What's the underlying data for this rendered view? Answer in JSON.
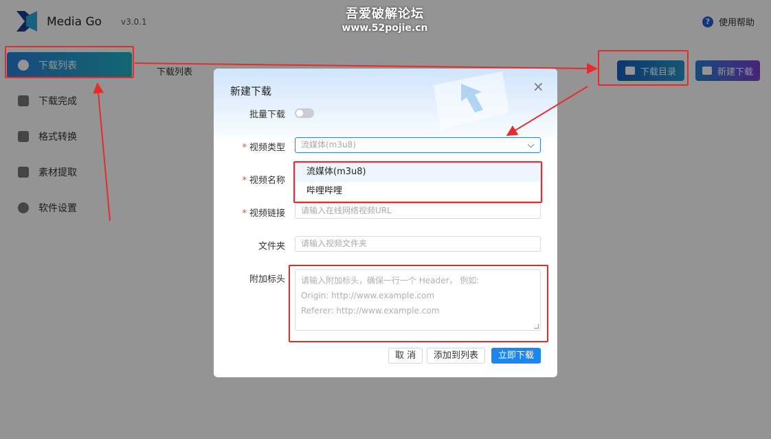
{
  "app": {
    "name": "Media Go",
    "version": "v3.0.1",
    "help_label": "使用帮助"
  },
  "watermark": {
    "line1": "吾爱破解论坛",
    "line2": "www.52pojie.cn"
  },
  "sidebar": {
    "items": [
      {
        "label": "下载列表",
        "active": true,
        "icon": "cloud-download-icon"
      },
      {
        "label": "下载完成",
        "active": false,
        "icon": "check-square-icon"
      },
      {
        "label": "格式转换",
        "active": false,
        "icon": "convert-icon"
      },
      {
        "label": "素材提取",
        "active": false,
        "icon": "extract-icon"
      },
      {
        "label": "软件设置",
        "active": false,
        "icon": "gear-icon"
      }
    ]
  },
  "main": {
    "title": "下载列表",
    "dir_button": "下载目录",
    "new_button": "新建下载"
  },
  "modal": {
    "title": "新建下载",
    "batch_label": "批量下载",
    "batch_enabled": false,
    "type_label": "视频类型",
    "type_value": "流媒体(m3u8)",
    "type_options": [
      "流媒体(m3u8)",
      "哔哩哔哩"
    ],
    "name_label": "视频名称",
    "link_label": "视频链接",
    "link_placeholder": "请输入在线网络视频URL",
    "folder_label": "文件夹",
    "folder_placeholder": "请输入视频文件夹",
    "header_label": "附加标头",
    "header_placeholder": [
      "请输入附加标头，确保一行一个 Header， 例如:",
      "Origin: http://www.example.com",
      "Referer: http://www.example.com"
    ],
    "cancel_label": "取 消",
    "add_label": "添加到列表",
    "download_label": "立即下载"
  },
  "colors": {
    "primary": "#1b86f0",
    "annotation": "#e62b2b",
    "required": "#e54545"
  }
}
